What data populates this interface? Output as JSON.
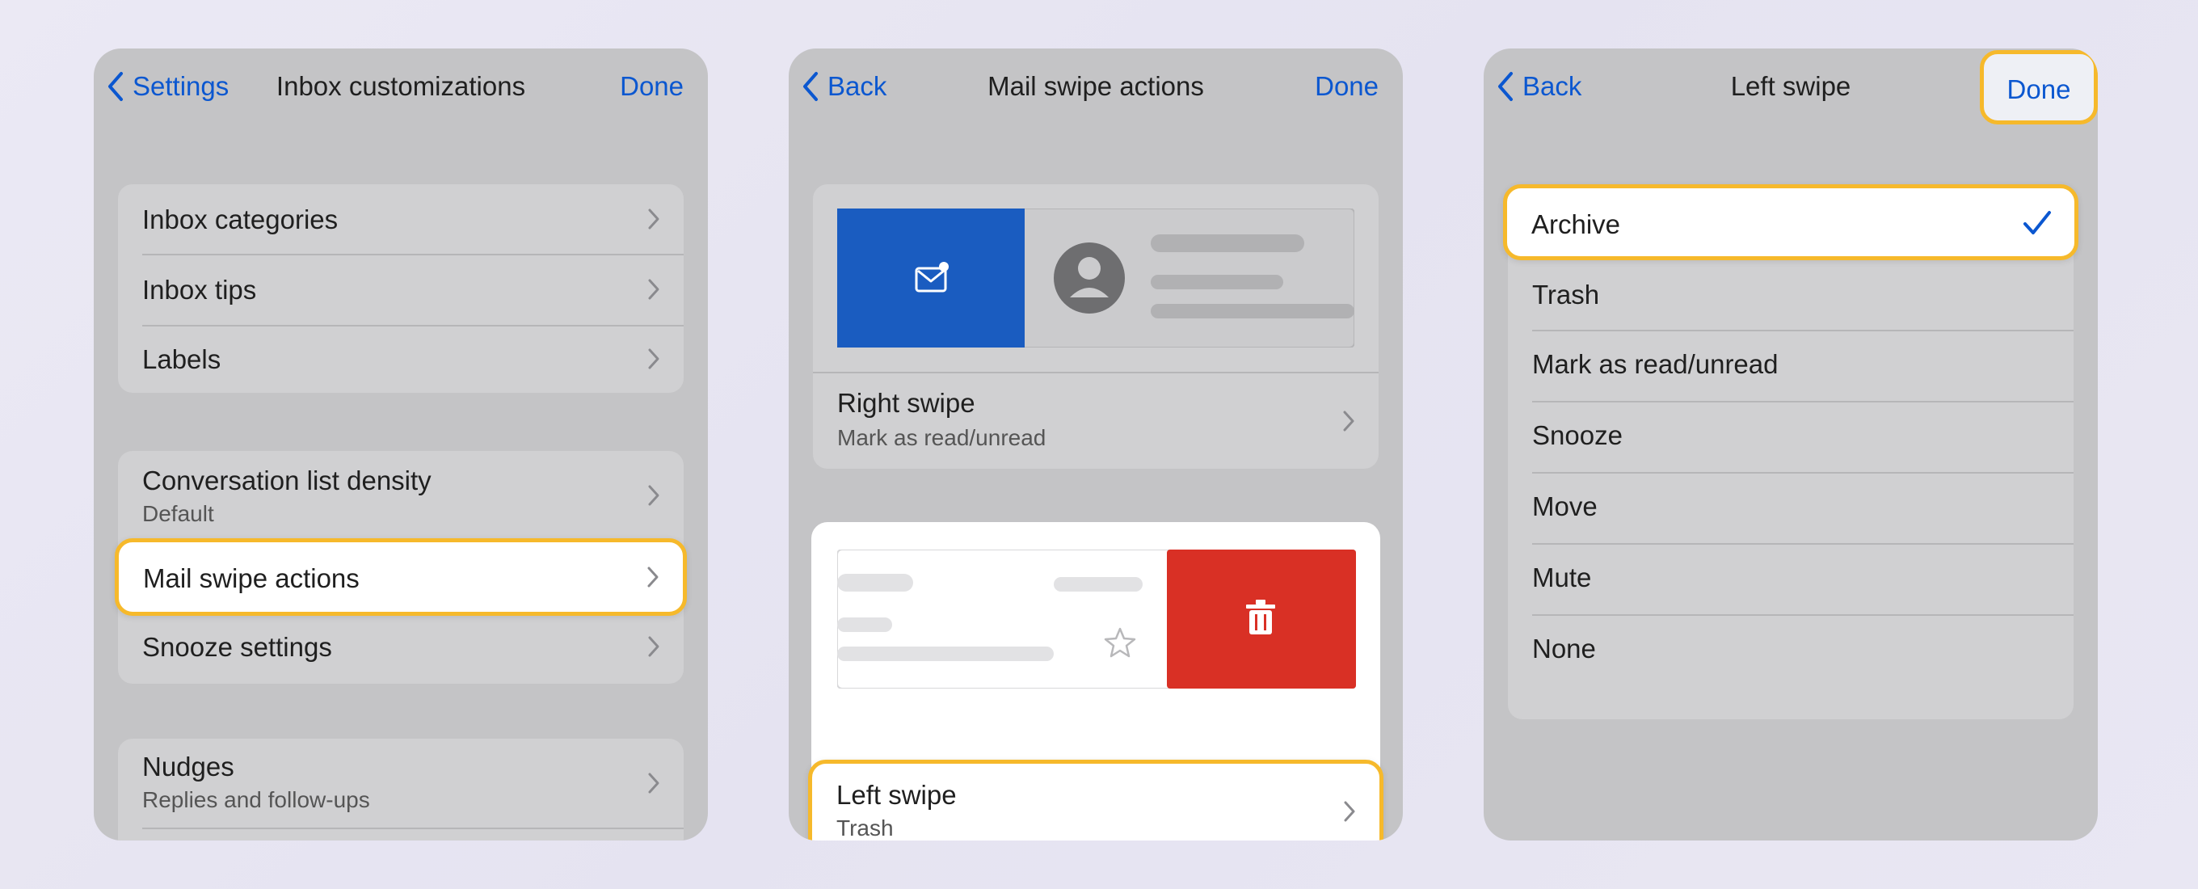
{
  "colors": {
    "accent": "#0b57d0",
    "highlight": "#f6b92b",
    "archive_blue": "#1a5cc0",
    "trash_red": "#d93025"
  },
  "panel1": {
    "back_label": "Settings",
    "title": "Inbox customizations",
    "done_label": "Done",
    "group1": [
      "Inbox categories",
      "Inbox tips",
      "Labels"
    ],
    "density": {
      "label": "Conversation list density",
      "value": "Default"
    },
    "mail_swipe_label": "Mail swipe actions",
    "snooze_label": "Snooze settings",
    "nudges": {
      "label": "Nudges",
      "value": "Replies and follow-ups"
    }
  },
  "panel2": {
    "back_label": "Back",
    "title": "Mail swipe actions",
    "done_label": "Done",
    "right_swipe": {
      "label": "Right swipe",
      "value": "Mark as read/unread",
      "icon": "mark-read-icon"
    },
    "left_swipe": {
      "label": "Left swipe",
      "value": "Trash",
      "icon": "trash-icon"
    }
  },
  "panel3": {
    "back_label": "Back",
    "title": "Left swipe",
    "done_label": "Done",
    "options": [
      "Archive",
      "Trash",
      "Mark as read/unread",
      "Snooze",
      "Move",
      "Mute",
      "None"
    ],
    "selected": "Archive"
  }
}
